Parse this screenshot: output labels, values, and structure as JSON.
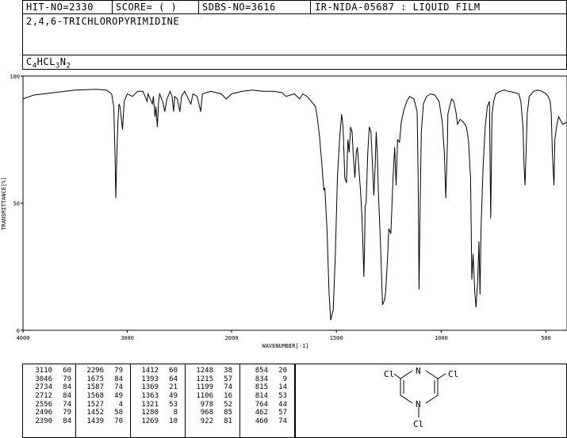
{
  "header": {
    "hit_no": "HIT-NO=2330",
    "score": "SCORE=  (   )",
    "sdbs_no": "SDBS-NO=3616",
    "ir_nida": "IR-NIDA-05687 : LIQUID FILM",
    "compound_name": "2,4,6-TRICHLOROPYRIMIDINE",
    "formula_parts": [
      {
        "t": "C",
        "sub": false
      },
      {
        "t": "4",
        "sub": true
      },
      {
        "t": "HCL",
        "sub": false
      },
      {
        "t": "3",
        "sub": true
      },
      {
        "t": "N",
        "sub": false
      },
      {
        "t": "2",
        "sub": true
      }
    ]
  },
  "chart_data": {
    "type": "line",
    "xlabel": "WAVENUMBER[-1]",
    "ylabel": "TRANSMITTANCE[%]",
    "xlim": [
      4000,
      400
    ],
    "ylim": [
      0,
      100
    ],
    "x_ticks": [
      4000,
      3000,
      2000,
      1500,
      1000,
      500
    ],
    "y_ticks": [
      0,
      50,
      100
    ],
    "series": [
      {
        "points": [
          [
            4000,
            91
          ],
          [
            3900,
            92.5
          ],
          [
            3700,
            93.5
          ],
          [
            3500,
            94.5
          ],
          [
            3300,
            94.8
          ],
          [
            3200,
            94.5
          ],
          [
            3150,
            93
          ],
          [
            3130,
            88
          ],
          [
            3118,
            70
          ],
          [
            3110,
            52
          ],
          [
            3100,
            70
          ],
          [
            3090,
            82
          ],
          [
            3080,
            89
          ],
          [
            3070,
            88
          ],
          [
            3046,
            79
          ],
          [
            3030,
            90
          ],
          [
            3000,
            93
          ],
          [
            2950,
            92
          ],
          [
            2900,
            94
          ],
          [
            2850,
            94
          ],
          [
            2830,
            92
          ],
          [
            2810,
            90
          ],
          [
            2800,
            93
          ],
          [
            2780,
            91
          ],
          [
            2760,
            89
          ],
          [
            2750,
            92
          ],
          [
            2734,
            84
          ],
          [
            2725,
            88
          ],
          [
            2712,
            80
          ],
          [
            2700,
            90
          ],
          [
            2690,
            93
          ],
          [
            2660,
            90
          ],
          [
            2640,
            86
          ],
          [
            2620,
            91
          ],
          [
            2590,
            94
          ],
          [
            2570,
            92
          ],
          [
            2556,
            86
          ],
          [
            2545,
            92
          ],
          [
            2520,
            91
          ],
          [
            2496,
            86
          ],
          [
            2480,
            92
          ],
          [
            2450,
            94
          ],
          [
            2390,
            89
          ],
          [
            2370,
            93
          ],
          [
            2330,
            92
          ],
          [
            2296,
            86
          ],
          [
            2280,
            93
          ],
          [
            2200,
            94
          ],
          [
            2100,
            93
          ],
          [
            2050,
            91
          ],
          [
            2000,
            93
          ],
          [
            1950,
            94
          ],
          [
            1900,
            94.5
          ],
          [
            1850,
            94
          ],
          [
            1800,
            94
          ],
          [
            1760,
            93.5
          ],
          [
            1740,
            92
          ],
          [
            1700,
            93
          ],
          [
            1675,
            91
          ],
          [
            1660,
            93
          ],
          [
            1640,
            92
          ],
          [
            1620,
            90
          ],
          [
            1600,
            88
          ],
          [
            1590,
            83
          ],
          [
            1580,
            76
          ],
          [
            1570,
            66
          ],
          [
            1560,
            55
          ],
          [
            1555,
            56
          ],
          [
            1545,
            40
          ],
          [
            1535,
            15
          ],
          [
            1527,
            4
          ],
          [
            1515,
            8
          ],
          [
            1505,
            30
          ],
          [
            1495,
            60
          ],
          [
            1485,
            75
          ],
          [
            1475,
            85
          ],
          [
            1468,
            80
          ],
          [
            1460,
            60
          ],
          [
            1452,
            58
          ],
          [
            1445,
            75
          ],
          [
            1439,
            70
          ],
          [
            1432,
            80
          ],
          [
            1425,
            78
          ],
          [
            1420,
            70
          ],
          [
            1412,
            60
          ],
          [
            1405,
            70
          ],
          [
            1400,
            72
          ],
          [
            1393,
            64
          ],
          [
            1385,
            55
          ],
          [
            1378,
            45
          ],
          [
            1372,
            30
          ],
          [
            1369,
            21
          ],
          [
            1365,
            35
          ],
          [
            1363,
            49
          ],
          [
            1358,
            50
          ],
          [
            1350,
            70
          ],
          [
            1343,
            80
          ],
          [
            1335,
            78
          ],
          [
            1328,
            65
          ],
          [
            1321,
            53
          ],
          [
            1315,
            65
          ],
          [
            1310,
            78
          ],
          [
            1305,
            70
          ],
          [
            1300,
            55
          ],
          [
            1290,
            35
          ],
          [
            1280,
            10
          ],
          [
            1270,
            12
          ],
          [
            1265,
            15
          ],
          [
            1255,
            30
          ],
          [
            1250,
            40
          ],
          [
            1240,
            38
          ],
          [
            1230,
            60
          ],
          [
            1222,
            72
          ],
          [
            1215,
            57
          ],
          [
            1208,
            75
          ],
          [
            1199,
            74
          ],
          [
            1190,
            82
          ],
          [
            1180,
            86
          ],
          [
            1165,
            90
          ],
          [
            1150,
            92
          ],
          [
            1130,
            91
          ],
          [
            1115,
            86
          ],
          [
            1110,
            60
          ],
          [
            1106,
            16
          ],
          [
            1100,
            50
          ],
          [
            1095,
            78
          ],
          [
            1085,
            89
          ],
          [
            1070,
            92
          ],
          [
            1050,
            93
          ],
          [
            1030,
            92.5
          ],
          [
            1010,
            90
          ],
          [
            995,
            82
          ],
          [
            985,
            70
          ],
          [
            978,
            52
          ],
          [
            970,
            75
          ],
          [
            968,
            85
          ],
          [
            960,
            88
          ],
          [
            950,
            91
          ],
          [
            940,
            90
          ],
          [
            930,
            86
          ],
          [
            922,
            81
          ],
          [
            910,
            83
          ],
          [
            895,
            82
          ],
          [
            880,
            80
          ],
          [
            870,
            75
          ],
          [
            860,
            60
          ],
          [
            854,
            20
          ],
          [
            848,
            30
          ],
          [
            840,
            15
          ],
          [
            834,
            9
          ],
          [
            826,
            20
          ],
          [
            820,
            35
          ],
          [
            815,
            14
          ],
          [
            810,
            40
          ],
          [
            800,
            65
          ],
          [
            790,
            80
          ],
          [
            780,
            88
          ],
          [
            770,
            90
          ],
          [
            764,
            44
          ],
          [
            758,
            85
          ],
          [
            750,
            90
          ],
          [
            740,
            93
          ],
          [
            720,
            94
          ],
          [
            700,
            94.5
          ],
          [
            680,
            94
          ],
          [
            650,
            93.5
          ],
          [
            630,
            93
          ],
          [
            620,
            90
          ],
          [
            610,
            80
          ],
          [
            605,
            65
          ],
          [
            600,
            57
          ],
          [
            595,
            70
          ],
          [
            590,
            85
          ],
          [
            580,
            92
          ],
          [
            560,
            94
          ],
          [
            540,
            94.5
          ],
          [
            520,
            94
          ],
          [
            500,
            93
          ],
          [
            490,
            92
          ],
          [
            480,
            90
          ],
          [
            475,
            85
          ],
          [
            470,
            70
          ],
          [
            462,
            57
          ],
          [
            458,
            75
          ],
          [
            450,
            80
          ],
          [
            440,
            84
          ],
          [
            420,
            81
          ],
          [
            400,
            82
          ]
        ]
      }
    ]
  },
  "peak_table": {
    "columns": [
      [
        [
          "3110",
          "60"
        ],
        [
          "3046",
          "79"
        ],
        [
          "2734",
          "84"
        ],
        [
          "2712",
          "84"
        ],
        [
          "2556",
          "74"
        ],
        [
          "2496",
          "79"
        ],
        [
          "2390",
          "84"
        ]
      ],
      [
        [
          "2296",
          "79"
        ],
        [
          "1675",
          "84"
        ],
        [
          "1587",
          "74"
        ],
        [
          "1568",
          "49"
        ],
        [
          "1527",
          "4"
        ],
        [
          "1452",
          "58"
        ],
        [
          "1439",
          "70"
        ]
      ],
      [
        [
          "1412",
          "60"
        ],
        [
          "1393",
          "64"
        ],
        [
          "1369",
          "21"
        ],
        [
          "1363",
          "49"
        ],
        [
          "1321",
          "53"
        ],
        [
          "1280",
          "8"
        ],
        [
          "1269",
          "10"
        ]
      ],
      [
        [
          "1248",
          "38"
        ],
        [
          "1215",
          "57"
        ],
        [
          "1199",
          "74"
        ],
        [
          "1106",
          "16"
        ],
        [
          "978",
          "52"
        ],
        [
          "968",
          "85"
        ],
        [
          "922",
          "81"
        ]
      ],
      [
        [
          "854",
          "20"
        ],
        [
          "834",
          "9"
        ],
        [
          "815",
          "14"
        ],
        [
          "814",
          "53"
        ],
        [
          "764",
          "44"
        ],
        [
          "462",
          "57"
        ],
        [
          "460",
          "74"
        ]
      ]
    ]
  },
  "structure": {
    "atom_labels": [
      "Cl",
      "N",
      "Cl",
      "N",
      "Cl"
    ]
  }
}
